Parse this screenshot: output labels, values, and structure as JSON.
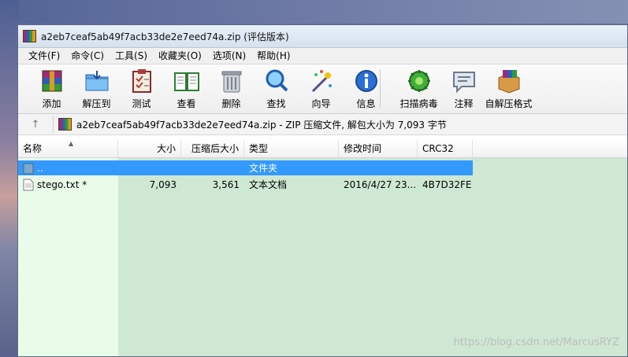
{
  "window": {
    "title": "a2eb7ceaf5ab49f7acb33de2e7eed74a.zip (评估版本)"
  },
  "menu": [
    "文件(F)",
    "命令(C)",
    "工具(S)",
    "收藏夹(O)",
    "选项(N)",
    "帮助(H)"
  ],
  "toolbar": [
    {
      "label": "添加",
      "icon": "archive-add-icon"
    },
    {
      "label": "解压到",
      "icon": "extract-folder-icon"
    },
    {
      "label": "测试",
      "icon": "test-clipboard-icon"
    },
    {
      "label": "查看",
      "icon": "view-book-icon"
    },
    {
      "label": "删除",
      "icon": "trash-icon"
    },
    {
      "label": "查找",
      "icon": "magnifier-icon"
    },
    {
      "label": "向导",
      "icon": "wizard-wand-icon"
    },
    {
      "label": "信息",
      "icon": "info-icon"
    },
    {
      "label": "扫描病毒",
      "icon": "virus-scan-icon"
    },
    {
      "label": "注释",
      "icon": "comment-icon"
    },
    {
      "label": "自解压格式",
      "icon": "sfx-box-icon"
    }
  ],
  "address": {
    "up_label": "↑",
    "path": "a2eb7ceaf5ab49f7acb33de2e7eed74a.zip - ZIP 压缩文件, 解包大小为 7,093 字节"
  },
  "columns": [
    "名称",
    "大小",
    "压缩后大小",
    "类型",
    "修改时间",
    "CRC32"
  ],
  "rows": [
    {
      "name": "..",
      "size": "",
      "packed": "",
      "type": "文件夹",
      "modified": "",
      "crc": "",
      "selected": true
    },
    {
      "name": "stego.txt *",
      "size": "7,093",
      "packed": "3,561",
      "type": "文本文档",
      "modified": "2016/4/27 23...",
      "crc": "4B7D32FE",
      "selected": false
    }
  ],
  "watermark": "https://blog.csdn.net/MarcusRYZ"
}
